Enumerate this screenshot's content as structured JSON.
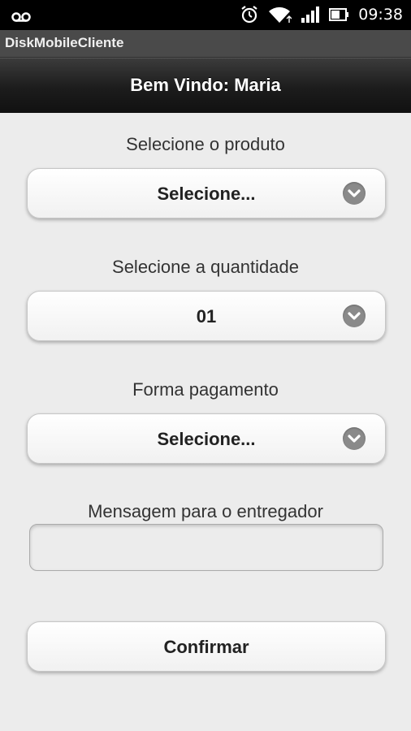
{
  "status_bar": {
    "time": "09:38"
  },
  "app": {
    "title": "DiskMobileCliente"
  },
  "header": {
    "title": "Bem Vindo: Maria"
  },
  "form": {
    "product": {
      "label": "Selecione o produto",
      "selected": "Selecione..."
    },
    "quantity": {
      "label": "Selecione a quantidade",
      "selected": "01"
    },
    "payment": {
      "label": "Forma pagamento",
      "selected": "Selecione..."
    },
    "message": {
      "label": "Mensagem para o entregador",
      "value": ""
    },
    "confirm_label": "Confirmar"
  },
  "icons": {
    "voicemail": "voicemail-icon",
    "alarm": "alarm-icon",
    "wifi": "wifi-icon",
    "signal": "signal-icon",
    "battery": "battery-icon",
    "chevron": "chevron-down-icon"
  }
}
